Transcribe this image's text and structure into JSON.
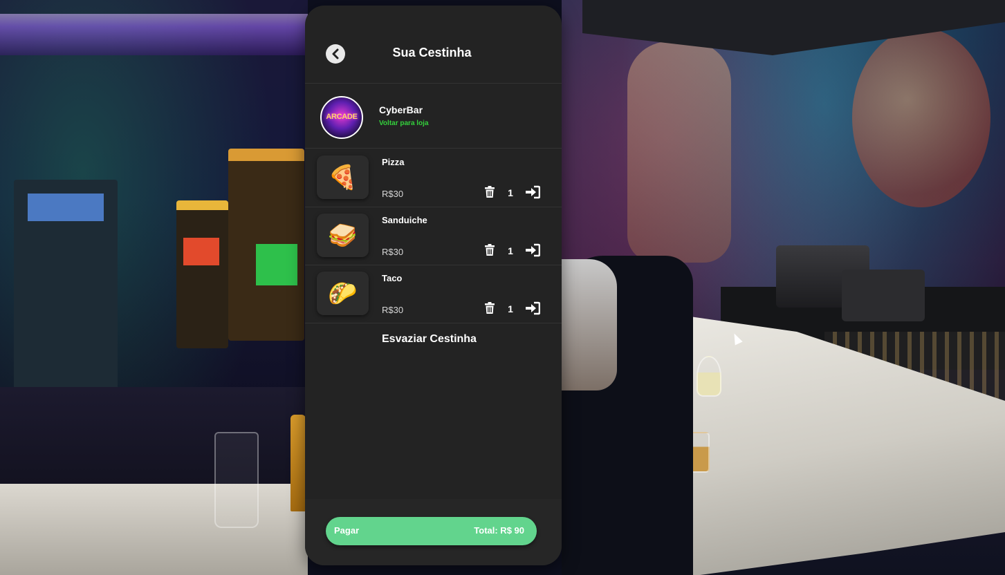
{
  "header": {
    "title": "Sua Cestinha",
    "back_icon": "chevron-left-icon"
  },
  "store": {
    "logo_text": "ARCADE",
    "name": "CyberBar",
    "link": "Voltar para loja",
    "link_color": "#34d13c"
  },
  "items": [
    {
      "name": "Pizza",
      "emoji": "🍕",
      "price": "R$30",
      "qty": "1"
    },
    {
      "name": "Sanduiche",
      "emoji": "🥪",
      "price": "R$30",
      "qty": "1"
    },
    {
      "name": "Taco",
      "emoji": "🌮",
      "price": "R$30",
      "qty": "1"
    }
  ],
  "actions": {
    "empty_cart": "Esvaziar Cestinha"
  },
  "footer": {
    "pay_label": "Pagar",
    "total": "Total: R$ 90",
    "pay_color": "#62d48d"
  },
  "colors": {
    "panel_bg": "#232323",
    "accent_green": "#34d13c"
  }
}
